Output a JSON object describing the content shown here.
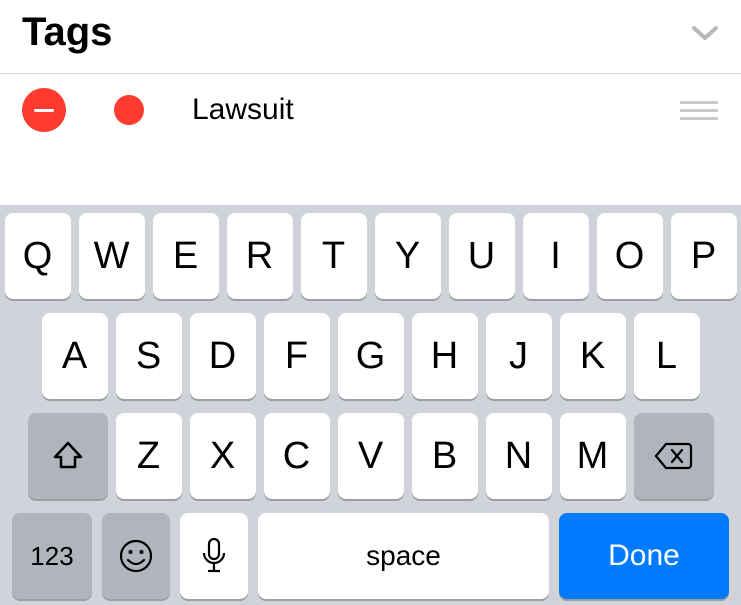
{
  "header": {
    "title": "Tags"
  },
  "tag": {
    "name": "Lawsuit",
    "color": "#ff3b30"
  },
  "keyboard": {
    "row1": [
      "Q",
      "W",
      "E",
      "R",
      "T",
      "Y",
      "U",
      "I",
      "O",
      "P"
    ],
    "row2": [
      "A",
      "S",
      "D",
      "F",
      "G",
      "H",
      "J",
      "K",
      "L"
    ],
    "row3": [
      "Z",
      "X",
      "C",
      "V",
      "B",
      "N",
      "M"
    ],
    "numbers_label": "123",
    "space_label": "space",
    "done_label": "Done"
  }
}
